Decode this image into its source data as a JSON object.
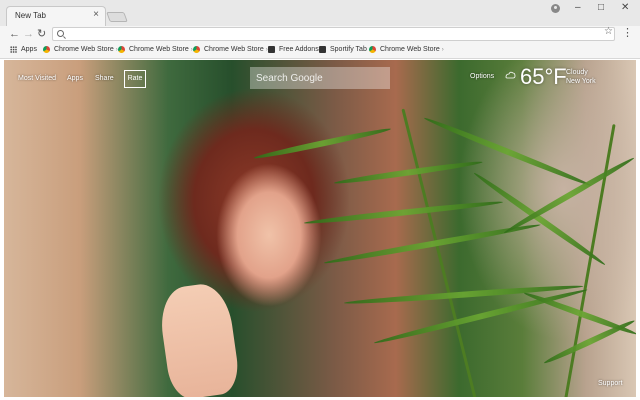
{
  "browser": {
    "tab_title": "New Tab",
    "close_glyph": "×",
    "window_controls": {
      "minimize": "–",
      "maximize": "□",
      "close": "✕"
    },
    "icons": [
      "profile-icon",
      "back-icon",
      "forward-icon",
      "reload-icon",
      "search-icon",
      "star-icon",
      "menu-icon"
    ]
  },
  "bookmarks": [
    {
      "label": "Apps",
      "icon": "apps-grid-icon"
    },
    {
      "label": "Chrome Web Store",
      "icon": "chrome-web-store-icon"
    },
    {
      "label": "Chrome Web Store",
      "icon": "chrome-web-store-icon"
    },
    {
      "label": "Chrome Web Store",
      "icon": "chrome-web-store-icon"
    },
    {
      "label": "Free Addons",
      "icon": "free-addons-icon"
    },
    {
      "label": "Sportify Tab",
      "icon": "sportify-tab-icon"
    },
    {
      "label": "Chrome Web Store",
      "icon": "chrome-web-store-icon"
    }
  ],
  "page": {
    "nav": {
      "most_visited": "Most Visited",
      "apps": "Apps",
      "share": "Share",
      "rate": "Rate"
    },
    "search_placeholder": "Search Google",
    "options": "Options",
    "weather": {
      "temperature": "65°F",
      "condition": "Cloudy",
      "location": "New York",
      "icon": "weather-icon"
    },
    "support": "Support"
  }
}
